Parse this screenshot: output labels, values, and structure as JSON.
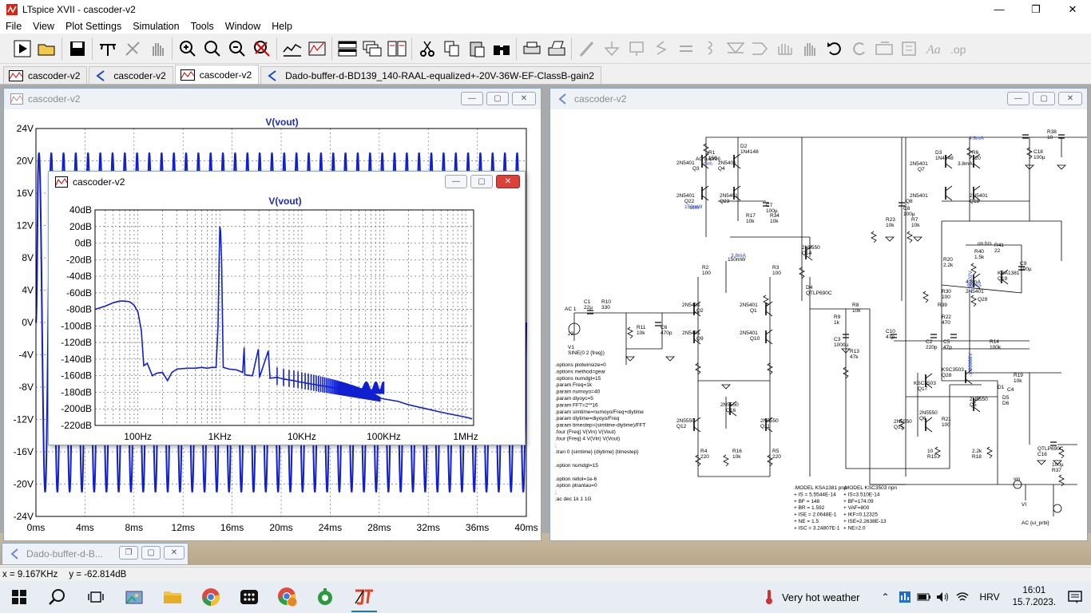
{
  "app": {
    "title": "LTspice XVII - cascoder-v2",
    "min": "—",
    "max": "❐",
    "close": "✕"
  },
  "menu": [
    "File",
    "View",
    "Plot Settings",
    "Simulation",
    "Tools",
    "Window",
    "Help"
  ],
  "toolbar_icons": [
    "run-icon",
    "open-icon",
    "save-icon",
    "control-panel-icon",
    "halt-icon",
    "pan-icon",
    "zoom-in-icon",
    "zoom-area-icon",
    "zoom-out-icon",
    "zoom-fit-icon",
    "autorange-icon",
    "autoscale-icon",
    "tile-horizontal-icon",
    "cascade-icon",
    "tile-vertical-icon",
    "cut-icon",
    "copy-icon",
    "paste-icon",
    "find-icon",
    "print-icon",
    "print-setup-icon",
    "wire-icon",
    "ground-icon",
    "label-icon",
    "resistor-icon",
    "capacitor-icon",
    "inductor-icon",
    "diode-icon",
    "component-icon",
    "move-icon",
    "drag-icon",
    "undo-icon",
    "redo-icon",
    "rotate-icon",
    "mirror-icon",
    "text-icon",
    "spice-directive-icon"
  ],
  "tabs": [
    {
      "label": "cascoder-v2",
      "icon": "waveform-icon",
      "active": false
    },
    {
      "label": "cascoder-v2",
      "icon": "schematic-icon",
      "active": false
    },
    {
      "label": "cascoder-v2",
      "icon": "waveform-icon",
      "active": true
    },
    {
      "label": "Dado-buffer-d-BD139_140-RAAL-equalized+-20V-36W-EF-ClassB-gain2",
      "icon": "schematic-icon",
      "active": false
    }
  ],
  "wave_window": {
    "title": "cascoder-v2",
    "trace": "V(vout)",
    "yticks": [
      "24V",
      "20V",
      "16V",
      "12V",
      "8V",
      "4V",
      "0V",
      "-4V",
      "-8V",
      "-12V",
      "-16V",
      "-20V",
      "-24V"
    ],
    "xticks": [
      "0ms",
      "4ms",
      "8ms",
      "12ms",
      "16ms",
      "20ms",
      "24ms",
      "28ms",
      "32ms",
      "36ms",
      "40ms"
    ]
  },
  "fft_window": {
    "title": "cascoder-v2",
    "trace": "V(vout)",
    "yticks": [
      "40dB",
      "20dB",
      "0dB",
      "-20dB",
      "-40dB",
      "-60dB",
      "-80dB",
      "-100dB",
      "-120dB",
      "-140dB",
      "-160dB",
      "-180dB",
      "-200dB",
      "-220dB"
    ],
    "xticks": [
      "100Hz",
      "1KHz",
      "10KHz",
      "100KHz",
      "1MHz"
    ]
  },
  "sch_window": {
    "title": "cascoder-v2",
    "directives": [
      ".options plotwinsize=0",
      ".options method=gear",
      ".options numdgt=15",
      ".param Freq=1k",
      ".param numoyo=40",
      ".param diyoyc=5",
      ".param FFT=2**16",
      ".param simtime=numoyo/Freq+diytime",
      ".param diytime=diyoyo/Freq",
      ".param timestep=(simtime-diytime)/FFT",
      ".four {Freq} V(Vin) V(Vout)",
      ".four {Freq} 4 V(Vin) V(Vout)",
      ";",
      ".tran 0 {simtime} {diytime} {timestep}",
      "",
      ".option numdgt=15",
      "",
      ".option reltol=1e-6",
      ".option ptrantau=0",
      ";",
      ";ac dec 1k 1 1G"
    ],
    "model1": [
      ".MODEL KSA1381 pnp",
      "+ IS = 5.5544E-14",
      "+ BF = 148",
      "+ BR = 1.592",
      "+ ISE = 2.0648E-1",
      "+ NE = 1.5",
      "+ ISC = 3.24807E-1"
    ],
    "model2": [
      ".MODEL KSC3503 npn",
      "+ IS=3.510E-14",
      "+ BF=174.09",
      "+ VAF=800",
      "+ IKF=0.12325",
      "+ ISE=2.2638E-13",
      "+ NE=2.0"
    ],
    "labels": [
      "2N5401",
      "Q3",
      "2N5401",
      "Q4",
      "2N5401",
      "Q22",
      "2N5401",
      "Q23",
      "2N5550",
      "Q14",
      "2N5401",
      "Q2",
      "2N5401",
      "Q1",
      "2N5401",
      "Q9",
      "2N5401",
      "Q10",
      "2N5550",
      "Q12",
      "2N5550",
      "Q11",
      "2N5550",
      "Q16",
      "2N5401",
      "Q7",
      "2N5401",
      "Q8",
      "2N5401",
      "Q18",
      "KSA1381",
      "Q19",
      "2N5401",
      "Q29",
      "KSC3503",
      "Q28",
      "KSC3503",
      "Q17",
      "2N5550",
      "Q5",
      "2N5550",
      "Q6",
      "2N5550",
      "Q15"
    ],
    "components": [
      "R1",
      "150",
      "D2",
      "1N4148",
      "C7",
      "100µ",
      "R17",
      "10k",
      "R34",
      "10k",
      "R2",
      "100",
      "R3",
      "100",
      "D4",
      "QTLP690C",
      "R8",
      "10k",
      "R9",
      "1k",
      "C3",
      "1000µ",
      "R13",
      "47k",
      "C1",
      "22µ",
      "R10",
      "330",
      "R11",
      "10k",
      "C6",
      "470p",
      "R4",
      "220",
      "R16",
      "10k",
      "R5",
      "220",
      "R38",
      "10",
      "C18",
      "100µ",
      "D3",
      "1N4148",
      "R6",
      "120",
      "C8",
      "100µ",
      "R23",
      "10k",
      "R7",
      "10k",
      "R20",
      "2.2k",
      "R40",
      "1.5k",
      "R41",
      "22",
      "C9",
      "100µ",
      "R30",
      "100",
      "R39",
      "R22",
      "470",
      "C10",
      "47p",
      "C2",
      "220p",
      "C5",
      "47p",
      "R14",
      "100k",
      "R21",
      "100",
      "R19",
      "10k",
      "D1",
      "C4",
      "D5",
      "D6",
      "QTLP690C",
      "C16",
      "100µ",
      "R37",
      "10",
      "R15",
      "2.2k",
      "R18",
      "22",
      "V1",
      "SINE(0 2 {freq})",
      "AC 1",
      "vin",
      "VI",
      "AC {ui_prbi}",
      "AC {uiprbi}",
      "trim",
      "150mW",
      "3.8mA",
      "4.8mA",
      "on h/s"
    ],
    "labels_blue": [
      "trim",
      "150mW",
      "3.8mA",
      "4.8mA",
      "on h/s",
      "1.36002V",
      "-1.86988V"
    ]
  },
  "min_window": {
    "title": "Dado-buffer-d-B..."
  },
  "status": {
    "x": "x = 9.167KHz",
    "y": "y = -62.814dB"
  },
  "taskbar": {
    "weather": "Very hot weather",
    "lang": "HRV",
    "time": "16:01",
    "date": "15.7.2023."
  }
}
